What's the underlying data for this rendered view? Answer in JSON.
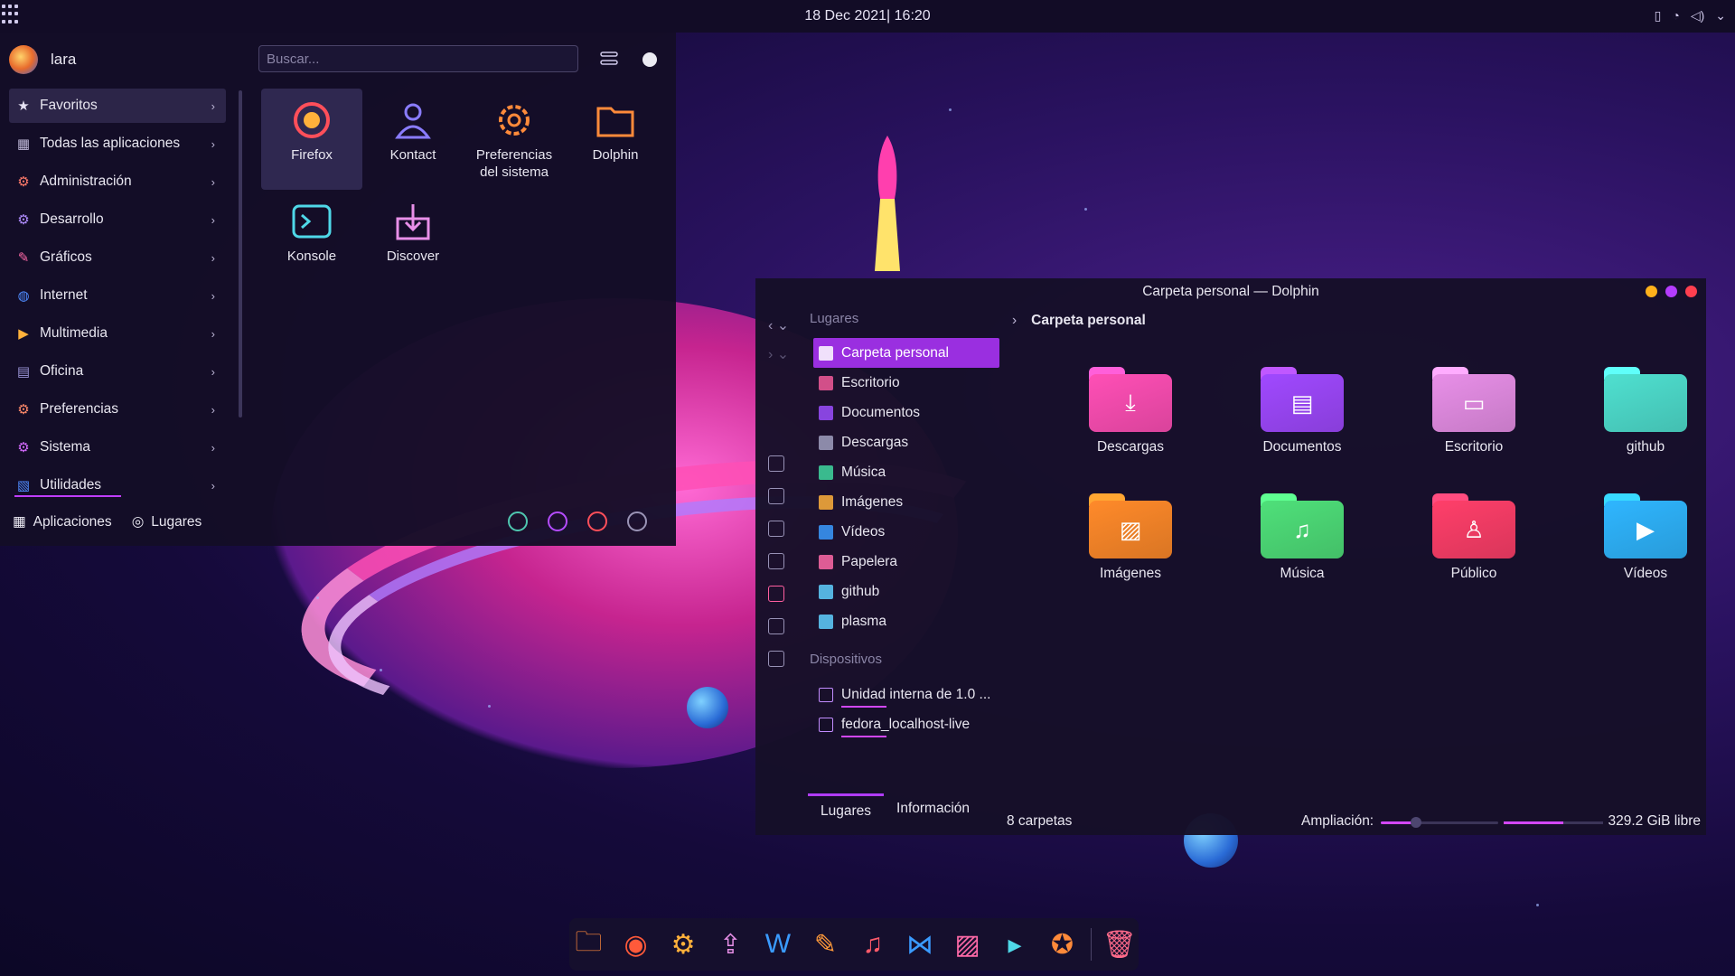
{
  "topbar": {
    "clock": "18 Dec 2021| 16:20"
  },
  "appmenu": {
    "user": "lara",
    "search_placeholder": "Buscar...",
    "categories": [
      {
        "label": "Favoritos",
        "icon": "star-icon"
      },
      {
        "label": "Todas las aplicaciones",
        "icon": "grid-icon"
      },
      {
        "label": "Administración",
        "icon": "gear-icon"
      },
      {
        "label": "Desarrollo",
        "icon": "gear-icon"
      },
      {
        "label": "Gráficos",
        "icon": "brush-icon"
      },
      {
        "label": "Internet",
        "icon": "globe-icon"
      },
      {
        "label": "Multimedia",
        "icon": "play-icon"
      },
      {
        "label": "Oficina",
        "icon": "document-icon"
      },
      {
        "label": "Preferencias",
        "icon": "gear-icon"
      },
      {
        "label": "Sistema",
        "icon": "gear-icon"
      },
      {
        "label": "Utilidades",
        "icon": "chart-icon"
      }
    ],
    "apps": [
      {
        "label": "Firefox",
        "icon": "firefox-icon"
      },
      {
        "label": "Kontact",
        "icon": "person-icon"
      },
      {
        "label": "Preferencias del sistema",
        "icon": "gear-icon"
      },
      {
        "label": "Dolphin",
        "icon": "folder-icon"
      },
      {
        "label": "Konsole",
        "icon": "terminal-icon"
      },
      {
        "label": "Discover",
        "icon": "download-box-icon"
      }
    ],
    "bottom_tabs": [
      "Aplicaciones",
      "Lugares"
    ]
  },
  "dolphin": {
    "title": "Carpeta personal — Dolphin",
    "places_title": "Lugares",
    "places": [
      {
        "label": "Carpeta personal",
        "color": "#ffffff"
      },
      {
        "label": "Escritorio",
        "color": "#f25a9a"
      },
      {
        "label": "Documentos",
        "color": "#9b4dff"
      },
      {
        "label": "Descargas",
        "color": "#a0a0c0"
      },
      {
        "label": "Música",
        "color": "#3fd8a0"
      },
      {
        "label": "Imágenes",
        "color": "#ffb13b"
      },
      {
        "label": "Vídeos",
        "color": "#3a9bff"
      },
      {
        "label": "Papelera",
        "color": "#ff6aa8"
      },
      {
        "label": "github",
        "color": "#5fd0ff"
      },
      {
        "label": "plasma",
        "color": "#5fd0ff"
      }
    ],
    "devices_title": "Dispositivos",
    "devices": [
      "Unidad interna de 1.0 ...",
      "fedora_localhost-live"
    ],
    "breadcrumb": "Carpeta personal",
    "folders": [
      {
        "label": "Descargas",
        "color": "#ff4fb6",
        "glyph": "⤓"
      },
      {
        "label": "Documentos",
        "color": "#a049ff",
        "glyph": "▤"
      },
      {
        "label": "Escritorio",
        "color": "#e88fe8",
        "glyph": "▭"
      },
      {
        "label": "github",
        "color": "#4fe0d0",
        "glyph": ""
      },
      {
        "label": "Imágenes",
        "color": "#ff8a2a",
        "glyph": "▨"
      },
      {
        "label": "Música",
        "color": "#4fe07a",
        "glyph": "♫"
      },
      {
        "label": "Público",
        "color": "#ff3f6a",
        "glyph": "♙"
      },
      {
        "label": "Vídeos",
        "color": "#2fb6ff",
        "glyph": "▶"
      }
    ],
    "tabs": [
      "Lugares",
      "Información"
    ],
    "status_count": "8 carpetas",
    "zoom_label": "Ampliación:",
    "zoom_level": 0.3,
    "space_used": 0.6,
    "free_space": "329.2 GiB libre"
  },
  "dock": [
    {
      "icon": "folder-icon",
      "color": "#ff8a3a",
      "glyph": "🗀"
    },
    {
      "icon": "firefox-icon",
      "color": "#ff5a3a",
      "glyph": "◉"
    },
    {
      "icon": "gear-icon",
      "color": "#ffb13b",
      "glyph": "⚙"
    },
    {
      "icon": "discover-icon",
      "color": "#e88fe8",
      "glyph": "⇪"
    },
    {
      "icon": "writer-icon",
      "color": "#3a9bff",
      "glyph": "W"
    },
    {
      "icon": "brush-icon",
      "color": "#ff9a3a",
      "glyph": "✎"
    },
    {
      "icon": "music-icon",
      "color": "#ff5a6a",
      "glyph": "♫"
    },
    {
      "icon": "vscode-icon",
      "color": "#3a9bff",
      "glyph": "⋈"
    },
    {
      "icon": "image-viewer-icon",
      "color": "#ff6aa8",
      "glyph": "▨"
    },
    {
      "icon": "terminal-icon",
      "color": "#4fd8e8",
      "glyph": "▸"
    },
    {
      "icon": "app-icon",
      "color": "#ff8a3a",
      "glyph": "✪"
    },
    {
      "icon": "trash-icon",
      "color": "#ff6a8a",
      "glyph": "🗑"
    }
  ]
}
